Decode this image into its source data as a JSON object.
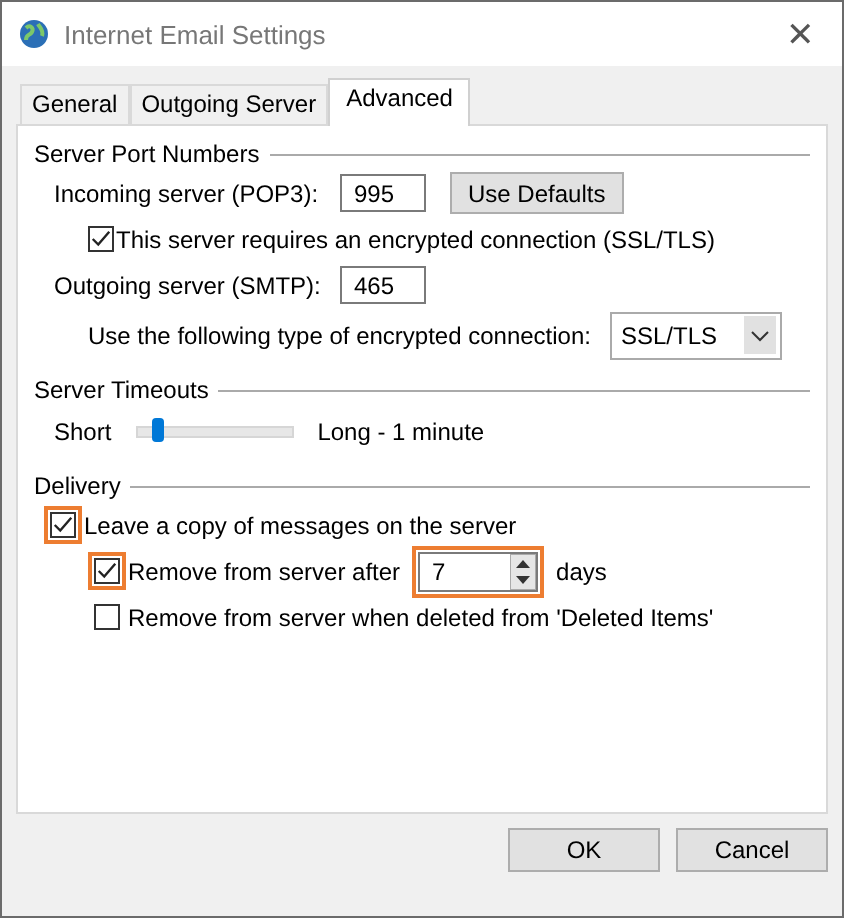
{
  "window": {
    "title": "Internet Email Settings",
    "close": "✕"
  },
  "tabs": [
    {
      "label": "General",
      "selected": false
    },
    {
      "label": "Outgoing Server",
      "selected": false
    },
    {
      "label": "Advanced",
      "selected": true
    }
  ],
  "server_port_numbers": {
    "title": "Server Port Numbers",
    "incoming_label": "Incoming server (POP3):",
    "incoming_value": "995",
    "use_defaults": "Use Defaults",
    "encrypted": {
      "label": "This server requires an encrypted connection (SSL/TLS)",
      "checked": true
    },
    "outgoing_label": "Outgoing server (SMTP):",
    "outgoing_value": "465",
    "encryption_label": "Use the following type of encrypted connection:",
    "encryption_value": "SSL/TLS"
  },
  "server_timeouts": {
    "title": "Server Timeouts",
    "short_label": "Short",
    "level": 0.1,
    "long_label": "Long - 1 minute"
  },
  "delivery": {
    "title": "Delivery",
    "leave_copy": {
      "label": "Leave a copy of messages on the server",
      "checked": true,
      "highlighted": true
    },
    "remove_after": {
      "label": "Remove from server after",
      "checked": true,
      "highlighted": true
    },
    "days_value": "7",
    "days_highlighted": true,
    "days_label": "days",
    "remove_deleted": {
      "label": "Remove from server when deleted from 'Deleted Items'",
      "checked": false
    }
  },
  "buttons": [
    "OK",
    "Cancel"
  ]
}
